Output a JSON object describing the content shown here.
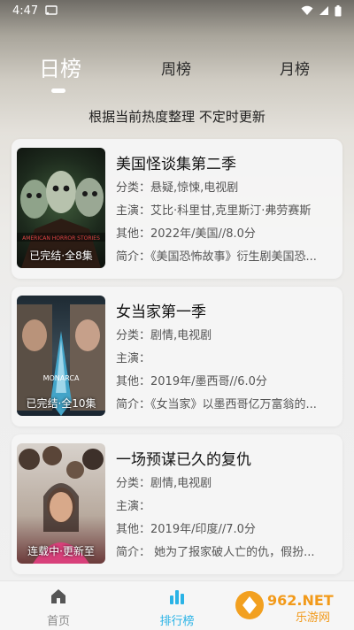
{
  "status_bar": {
    "time": "4:47"
  },
  "tabs": [
    {
      "label": "日榜",
      "active": true
    },
    {
      "label": "周榜",
      "active": false
    },
    {
      "label": "月榜",
      "active": false
    }
  ],
  "subtitle": "根据当前热度整理 不定时更新",
  "items": [
    {
      "title": "美国怪谈集第二季",
      "genre": "分类：悬疑,惊悚,电视剧",
      "cast": "主演：艾比·科里甘,克里斯汀·弗劳赛斯",
      "other": "其他：2022年/美国//8.0分",
      "intro": "简介：《美国恐怖故事》衍生剧美国恐...",
      "poster_status": "已完结·全8集",
      "poster_text": "AMERICAN HORROR STORIES"
    },
    {
      "title": "女当家第一季",
      "genre": "分类：剧情,电视剧",
      "cast": "主演：",
      "other": "其他：2019年/墨西哥//6.0分",
      "intro": "简介：《女当家》以墨西哥亿万富翁的...",
      "poster_status": "已完结·全10集",
      "poster_text": "MONARCA"
    },
    {
      "title": "一场预谋已久的复仇",
      "genre": "分类：剧情,电视剧",
      "cast": "主演：",
      "other": "其他：2019年/印度//7.0分",
      "intro": "简介：    她为了报家破人亡的仇，假扮...",
      "poster_status": "连载中·更新至",
      "poster_text": ""
    }
  ],
  "bottom_nav": [
    {
      "label": "首页",
      "icon": "home-icon",
      "active": false
    },
    {
      "label": "排行榜",
      "icon": "ranking-icon",
      "active": true
    }
  ],
  "watermark": {
    "brand": "962.NET",
    "sub": "乐游网"
  },
  "colors": {
    "accent": "#2ab3e6",
    "inactive": "#8a8a8a"
  }
}
